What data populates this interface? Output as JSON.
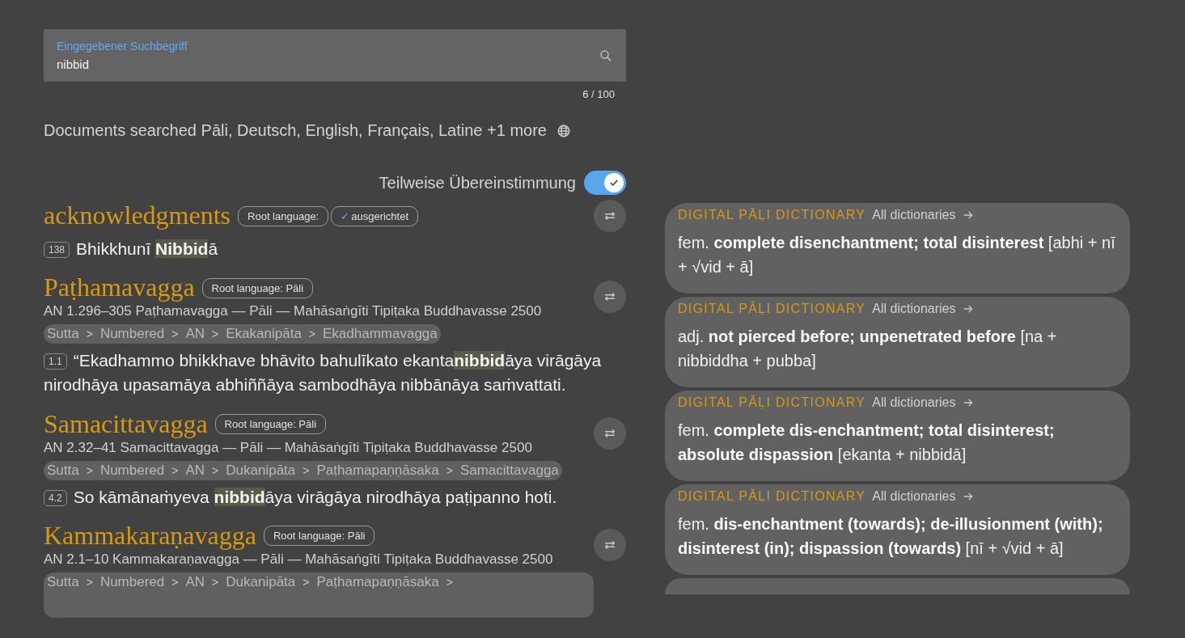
{
  "search": {
    "label": "Eingegebener Suchbegriff",
    "value": "nibbid",
    "counter": "6 / 100"
  },
  "documents_searched": "Documents searched Pāli, Deutsch, English, Français, Latine +1 more",
  "partial_match": {
    "label": "Teilweise Übereinstimmung",
    "on": true
  },
  "results": [
    {
      "title": "acknowledgments",
      "badges": [
        {
          "label": "Root language:"
        },
        {
          "mark": "✓",
          "label": "ausgerichtet"
        }
      ],
      "segments": [
        {
          "number": "138",
          "text": "Bhikkhunī **Nibbid**ā"
        }
      ]
    },
    {
      "title": "Paṭhamavagga",
      "badges": [
        {
          "label": "Root language: Pāli"
        }
      ],
      "subtitle": "AN 1.296–305 Paṭhamavagga — Pāli — Mahāsaṅgīti Tipiṭaka Buddhavasse 2500",
      "breadcrumb": {
        "separator": ">",
        "items": [
          "Sutta",
          "Numbered",
          "AN",
          "Ekakanipāta",
          "Ekadhammavagga"
        ],
        "trailing_separator": false
      },
      "segments": [
        {
          "number": "1.1",
          "text": "“Ekadhammo bhikkhave bhāvito bahulīkato ekanta**nibbid**āya virāgāya nirodhāya upasamāya abhiññāya sambodhāya nibbānāya saṁvattati."
        }
      ]
    },
    {
      "title": "Samacittavagga",
      "badges": [
        {
          "label": "Root language: Pāli"
        }
      ],
      "subtitle": "AN 2.32–41 Samacittavagga — Pāli — Mahāsaṅgīti Tipiṭaka Buddhavasse 2500",
      "breadcrumb": {
        "separator": ">",
        "items": [
          "Sutta",
          "Numbered",
          "AN",
          "Dukanipāta",
          "Paṭhamapaṇṇāsaka",
          "Samacittavagga"
        ],
        "trailing_separator": false
      },
      "segments": [
        {
          "number": "4.2",
          "text": "So kāmānaṁyeva **nibbid**āya virāgāya nirodhāya paṭipanno hoti."
        }
      ]
    },
    {
      "title": "Kammakaraṇavagga",
      "badges": [
        {
          "label": "Root language: Pāli"
        }
      ],
      "subtitle": "AN 2.1–10 Kammakaraṇavagga — Pāli — Mahāsaṅgīti Tipiṭaka Buddhavasse 2500",
      "breadcrumb": {
        "separator": ">",
        "items": [
          "Sutta",
          "Numbered",
          "AN",
          "Dukanipāta",
          "Paṭhamapaṇṇāsaka"
        ],
        "trailing_separator": true
      }
    }
  ],
  "dictionary": [
    {
      "source": "DIGITAL PĀḶI DICTIONARY",
      "link": "All dictionaries",
      "definition": "fem. **complete disenchantment; total disinterest** [abhi + nī + √vid + ā]"
    },
    {
      "source": "DIGITAL PĀḶI DICTIONARY",
      "link": "All dictionaries",
      "definition": "adj. **not pierced before; unpenetrated before** [na + nibbiddha + pubba]"
    },
    {
      "source": "DIGITAL PĀḶI DICTIONARY",
      "link": "All dictionaries",
      "definition": "fem. **complete dis-enchantment; total disinterest; absolute dispassion** [ekanta + nibbidā]"
    },
    {
      "source": "DIGITAL PĀḶI DICTIONARY",
      "link": "All dictionaries",
      "definition": "fem. **dis-enchantment (towards); de-illusionment (with); disinterest (in); dispassion (towards)** [nī + √vid + ā]"
    }
  ]
}
